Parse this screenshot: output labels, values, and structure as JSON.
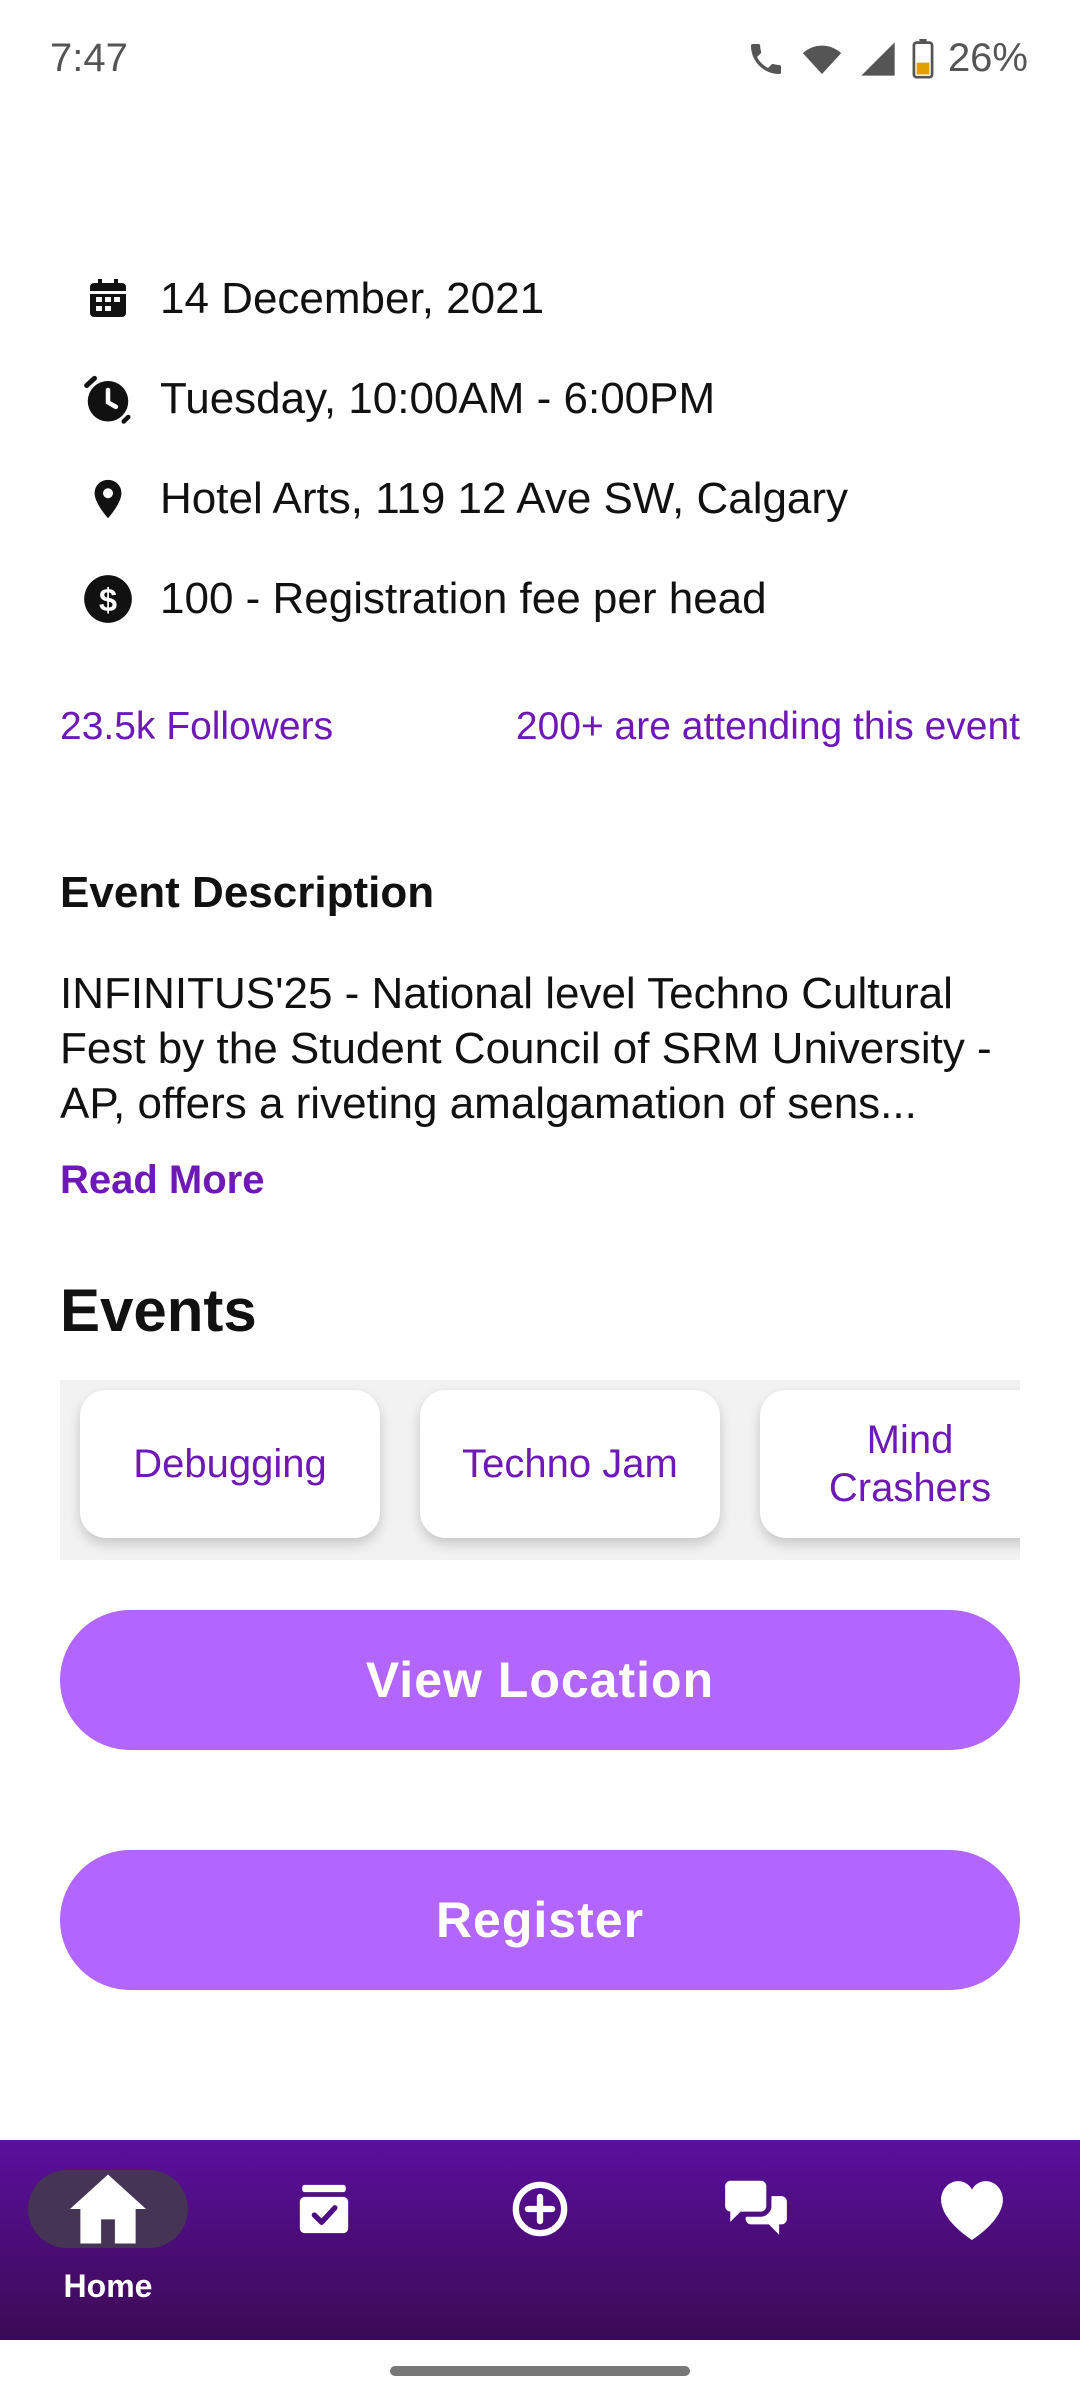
{
  "status": {
    "time": "7:47",
    "battery": "26%"
  },
  "details": {
    "date": "14 December, 2021",
    "time": "Tuesday, 10:00AM - 6:00PM",
    "location": "Hotel Arts, 119 12 Ave SW, Calgary",
    "fee": "100 - Registration fee per head"
  },
  "stats": {
    "followers": "23.5k Followers",
    "attending": "200+ are attending this event"
  },
  "description": {
    "title": "Event Description",
    "text": "INFINITUS'25 - National level Techno Cultural Fest by the Student Council of SRM University - AP, offers a riveting amalgamation of sens...",
    "read_more": "Read More"
  },
  "events": {
    "title": "Events",
    "chips": [
      "Debugging",
      "Techno Jam",
      "Mind Crashers"
    ]
  },
  "buttons": {
    "view_location": "View Location",
    "register": "Register"
  },
  "nav": {
    "home_label": "Home",
    "icons": [
      "home-icon",
      "calendar-check-icon",
      "add-circle-icon",
      "chat-icon",
      "heart-icon"
    ]
  },
  "colors": {
    "accent": "#6f18b8",
    "button": "#b266ff",
    "nav_top": "#5b0f9d",
    "nav_bottom": "#3b0b54"
  }
}
